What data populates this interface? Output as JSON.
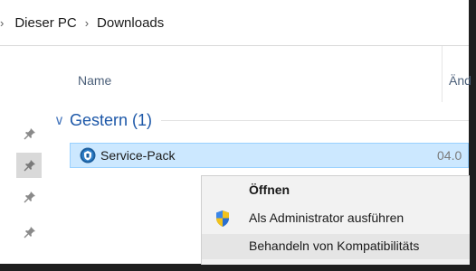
{
  "breadcrumb": {
    "items": [
      "Dieser PC",
      "Downloads"
    ],
    "separator": "›"
  },
  "columns": {
    "name": "Name",
    "date": "Änd"
  },
  "group": {
    "label": "Gestern (1)"
  },
  "file": {
    "name": "Service-Pack",
    "date": "04.0"
  },
  "context_menu": {
    "items": [
      {
        "label": "Öffnen",
        "bold": true
      },
      {
        "label": "Als Administrator ausführen",
        "icon": "uac-shield-icon"
      },
      {
        "label": "Behandeln von Kompatibilitäts"
      }
    ]
  },
  "colors": {
    "selection_bg": "#cce8ff",
    "selection_border": "#99d1ff",
    "group_text": "#1c57a8",
    "menu_bg": "#f2f2f2"
  }
}
